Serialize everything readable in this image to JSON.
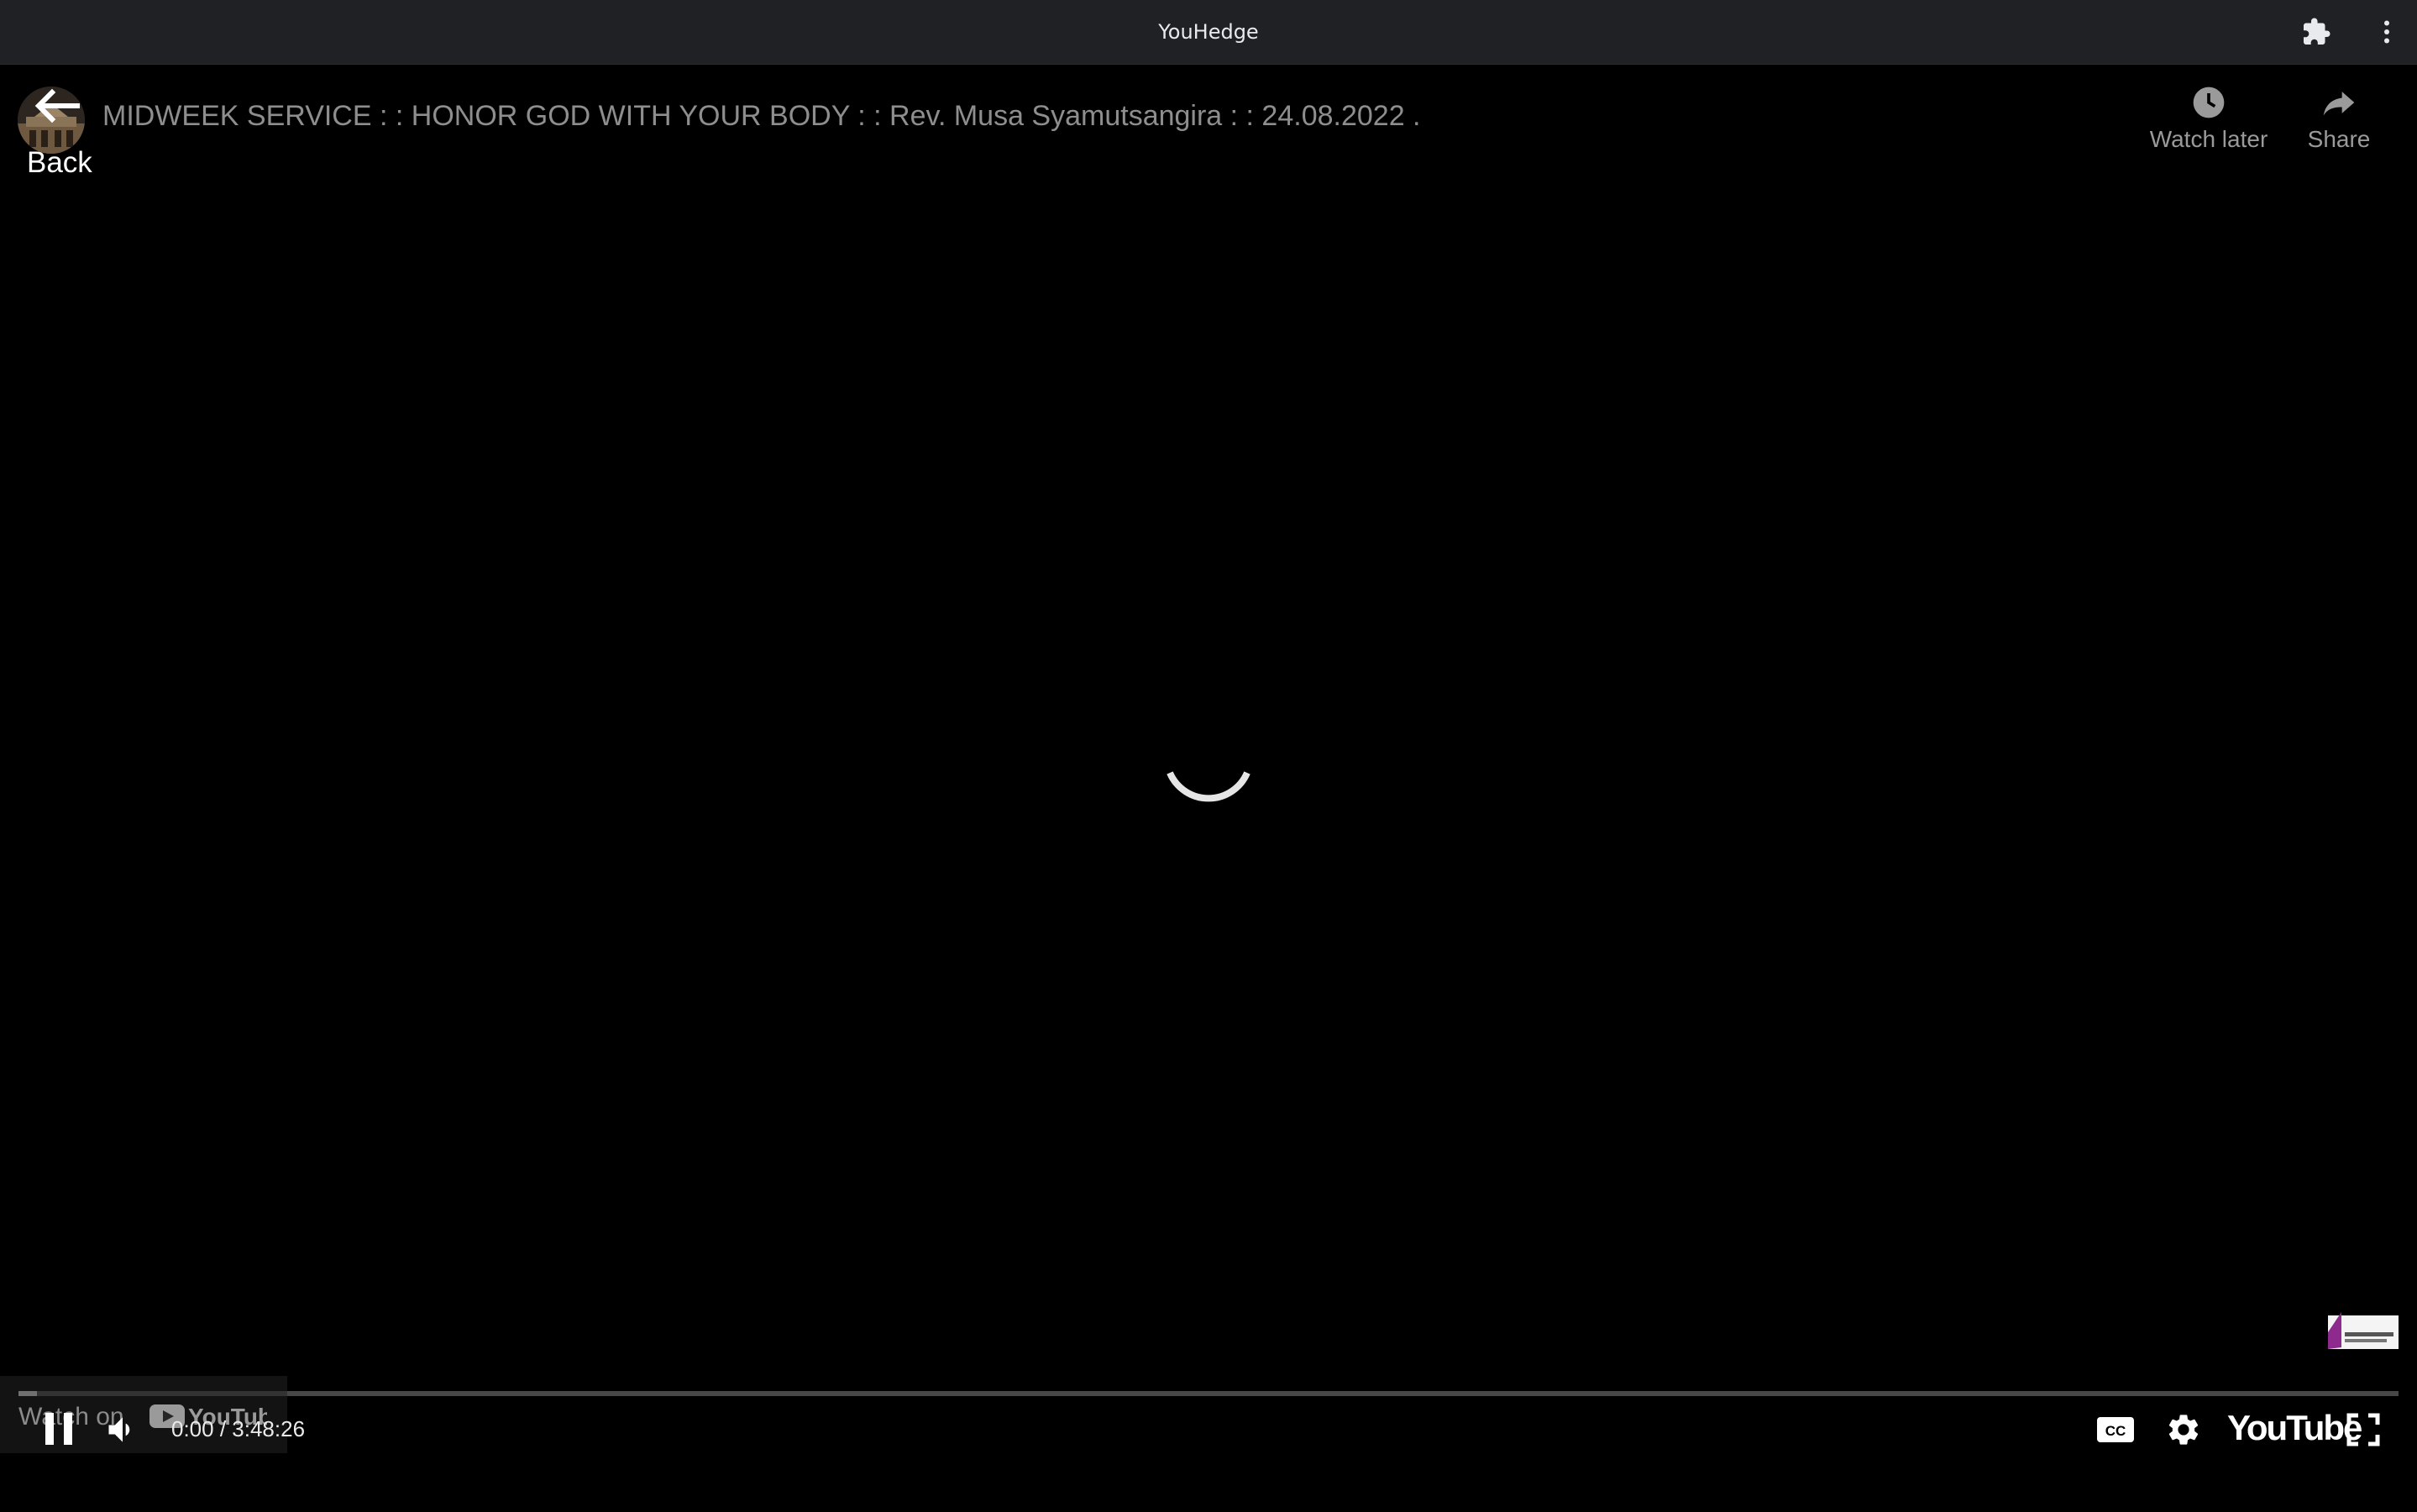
{
  "window": {
    "title": "YouHedge",
    "icons": {
      "extensions": "puzzle-piece-icon",
      "menu": "three-dots-vertical-icon"
    }
  },
  "player": {
    "back_label": "Back",
    "video_title": "MIDWEEK SERVICE : : HONOR GOD WITH YOUR BODY : : Rev. Musa Syamutsangira : : 24.08.2022 .",
    "top_actions": {
      "watch_later": {
        "label": "Watch later",
        "icon": "clock-icon"
      },
      "share": {
        "label": "Share",
        "icon": "share-arrow-icon"
      }
    },
    "state": "loading",
    "controls": {
      "play_state": "playing",
      "current_time": "0:00",
      "time_separator": " / ",
      "duration": "3:48:26",
      "progress_fraction": 0.0,
      "watch_on_label": "Watch on",
      "watch_on_brand": "YouTube",
      "brand_label": "YouTube",
      "icons": {
        "play_pause": "pause-icon",
        "volume": "volume-icon",
        "captions": "cc-icon",
        "settings": "gear-icon",
        "fullscreen": "fullscreen-icon"
      }
    },
    "colors": {
      "background": "#000000",
      "title_bar": "#202124",
      "progress_fill": "#cfcfcf",
      "watermark_accent": "#8e2a8e"
    }
  }
}
